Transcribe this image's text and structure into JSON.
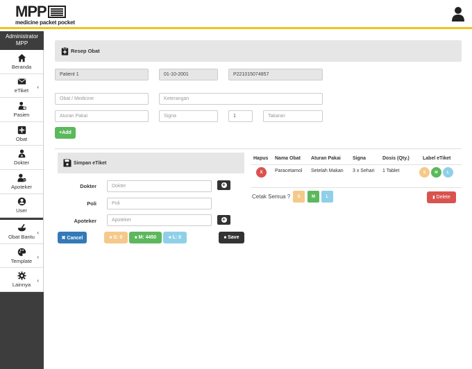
{
  "header": {
    "logo_title": "MPP",
    "logo_subtitle": "medicine packet pocket"
  },
  "sidebar": {
    "user_line1": "Administrator",
    "user_line2": "MPP",
    "items": [
      {
        "label": "Beranda",
        "icon": "home-icon"
      },
      {
        "label": "eTiket",
        "icon": "envelope-icon",
        "chevron": "‹"
      },
      {
        "label": "Pasien",
        "icon": "patient-icon"
      },
      {
        "label": "Obat",
        "icon": "plus-square-icon"
      },
      {
        "label": "Dokter",
        "icon": "doctor-icon"
      },
      {
        "label": "Apoteker",
        "icon": "pharmacist-icon"
      },
      {
        "label": "User",
        "icon": "user-circle-icon"
      },
      {
        "label": "Obat Bantu",
        "icon": "mortar-icon",
        "chevron": "‹"
      },
      {
        "label": "Template",
        "icon": "palette-icon",
        "chevron": "‹"
      },
      {
        "label": "Lainnya",
        "icon": "gear-icon",
        "chevron": "‹"
      }
    ]
  },
  "resep": {
    "title": "Resep Obat",
    "patient_name": "Patient 1",
    "birth_date": "01-10-2001",
    "patient_id": "P221015074857",
    "obat_placeholder": "Obat / Medicine",
    "keterangan_placeholder": "Keterangan",
    "aturan_placeholder": "Aturan Pakai",
    "signa_placeholder": "Signa",
    "qty_value": "1",
    "takaran_placeholder": "Takaran",
    "add_label": "+Add"
  },
  "simpan": {
    "title": "Simpan eTiket",
    "dokter_label": "Dokter",
    "dokter_placeholder": "Dokter",
    "poli_label": "Poli",
    "poli_placeholder": "Poli",
    "apoteker_label": "Apoteker",
    "apoteker_placeholder": "Apoteker",
    "cancel_label": "✖ Cancel",
    "s_label": "S: 0",
    "m_label": "M: 4450",
    "l_label": "L: 0",
    "save_label": "Save"
  },
  "table": {
    "headers": [
      "Hapus",
      "Nama Obat",
      "Aturan Pakai",
      "Signa",
      "Dosis (Qty.)",
      "Label eTiket"
    ],
    "rows": [
      {
        "hapus": "X",
        "nama": "Paracetamol",
        "aturan": "Setelah Makan",
        "signa": "3 x Sehari",
        "dosis": "1 Tablet",
        "labels": [
          "S",
          "M",
          "L"
        ]
      }
    ]
  },
  "footer_actions": {
    "cetak_label": "Cetak Semua ?",
    "s": "S",
    "m": "M",
    "l": "L",
    "delete_label": "Delete"
  },
  "colors": {
    "accent_yellow": "#f0c419",
    "green": "#5cb85c",
    "blue": "#337ab7",
    "orange": "#f0ad4e",
    "light_orange": "#f5c98a",
    "light_blue": "#8fd0e8",
    "red": "#d9534f",
    "dark": "#333333"
  }
}
